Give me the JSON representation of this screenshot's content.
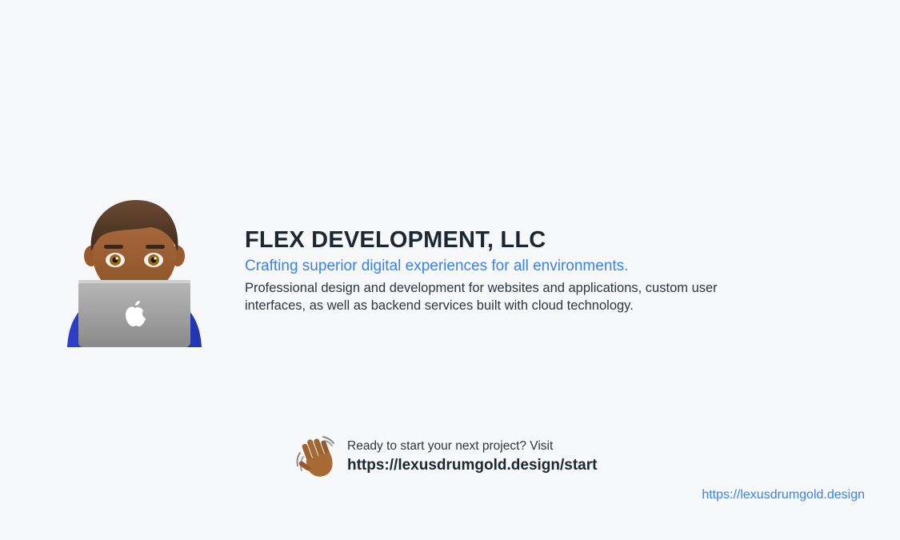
{
  "hero": {
    "avatar_icon": "technologist-with-laptop-icon",
    "title": "FLEX DEVELOPMENT, LLC",
    "tagline": "Crafting superior digital experiences for all environments.",
    "description": "Professional design and development for websites and applications, custom user interfaces, as well as backend services built with cloud technology."
  },
  "cta": {
    "icon": "waving-hand-icon",
    "prompt": "Ready to start your next project? Visit",
    "link_text": "https://lexusdrumgold.design/start"
  },
  "footer": {
    "link_text": "https://lexusdrumgold.design"
  },
  "colors": {
    "background": "#f7f8fa",
    "title": "#1b2733",
    "accent": "#3b82e6",
    "body_text": "#2c3640"
  }
}
